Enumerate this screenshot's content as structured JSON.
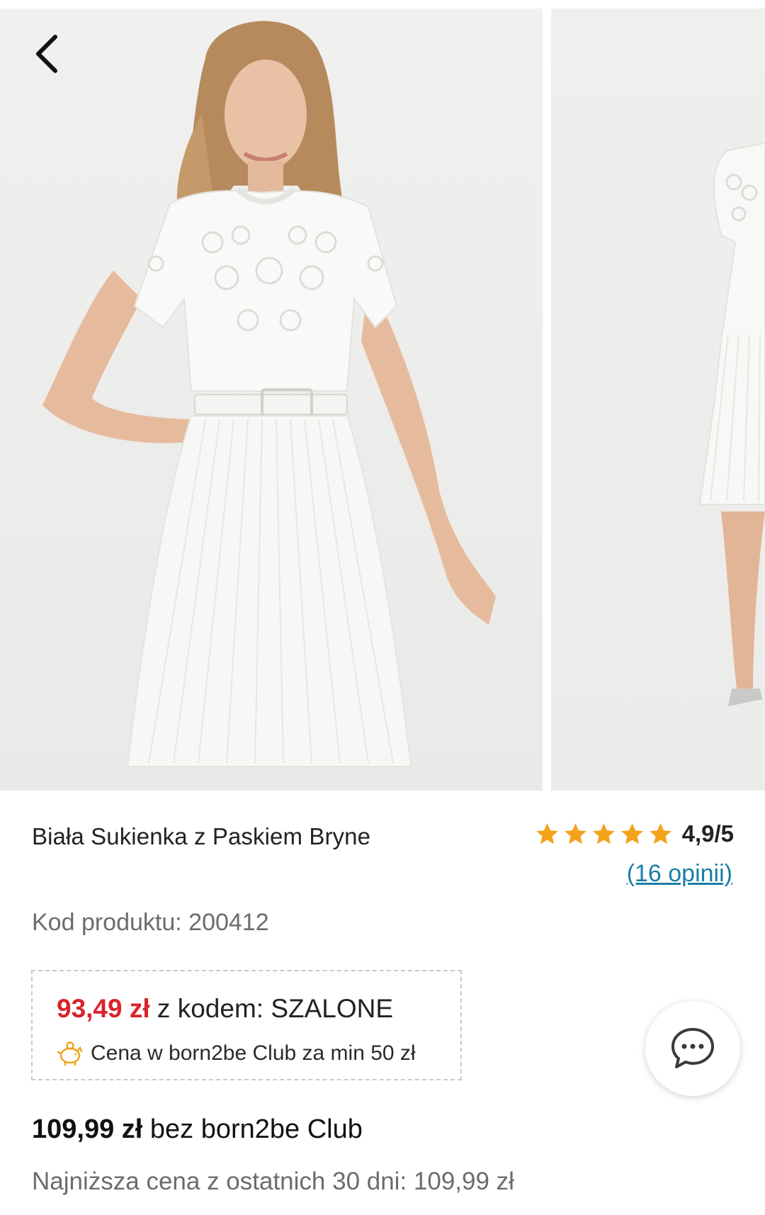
{
  "gallery": {
    "main_image_alt": "Biała Sukienka z Paskiem Bryne",
    "next_image_alt": "Biała Sukienka z Paskiem Bryne"
  },
  "icons": {
    "back": "chevron-left-icon",
    "star": "star-icon",
    "piggy": "piggy-bank-icon",
    "chat": "chat-bubble-icon"
  },
  "colors": {
    "accent_price": "#d8242c",
    "link": "#1a7fa6",
    "star": "#f5a21b"
  },
  "product": {
    "title": "Biała Sukienka z Paskiem Bryne",
    "rating": "4,9/5",
    "stars": 5,
    "reviews_link": "(16 opinii)",
    "code_label": "Kod produktu: ",
    "code_value": "200412"
  },
  "promo": {
    "price": "93,49 zł",
    "code_text": " z kodem: SZALONE",
    "club_note": "Cena w born2be Club za min 50 zł"
  },
  "pricing": {
    "regular_amount": "109,99 zł",
    "regular_suffix": " bez born2be Club",
    "lowest_30_days": "Najniższa cena z ostatnich 30 dni: 109,99 zł"
  }
}
